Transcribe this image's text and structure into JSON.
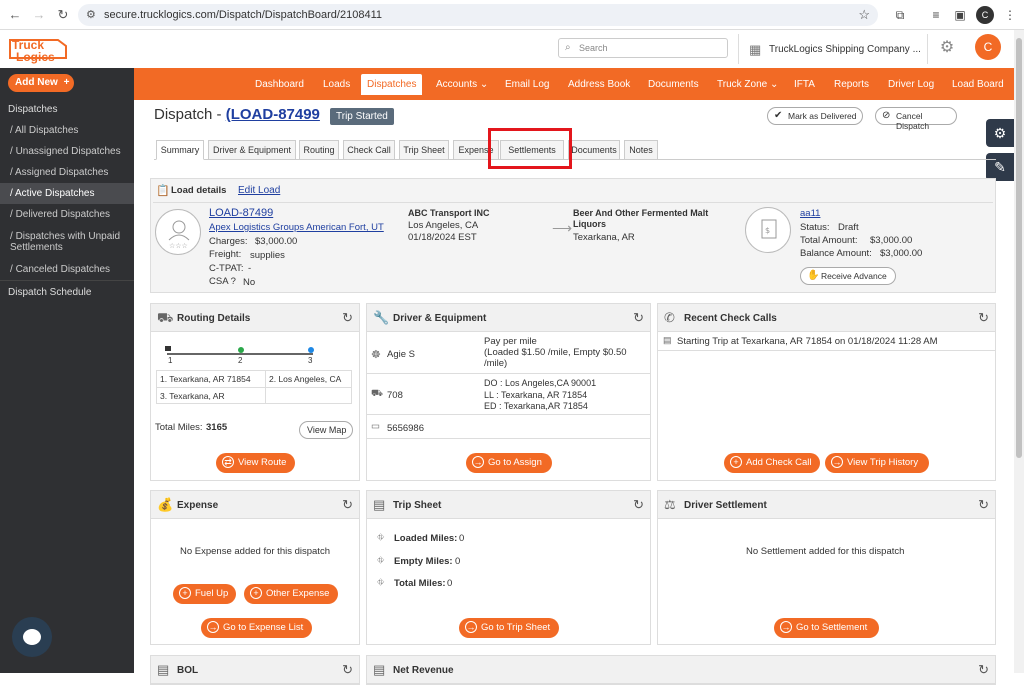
{
  "browser": {
    "url": "secure.trucklogics.com/Dispatch/DispatchBoard/2108411",
    "profile": "C"
  },
  "header": {
    "search_placeholder": "Search",
    "company": "TruckLogics Shipping Company ...",
    "avatar": "C",
    "logo": "TruckLogics"
  },
  "sidebar": {
    "add_new": "Add New",
    "section": "Dispatches",
    "items": [
      "All Dispatches",
      "Unassigned Dispatches",
      "Assigned Dispatches",
      "Active Dispatches",
      "Delivered Dispatches",
      "Dispatches with Unpaid Settlements",
      "Canceled Dispatches"
    ],
    "schedule": "Dispatch Schedule"
  },
  "topnav": [
    "Dashboard",
    "Loads",
    "Dispatches",
    "Accounts",
    "Email Log",
    "Address Book",
    "Documents",
    "Truck Zone",
    "IFTA",
    "Reports",
    "Driver Log",
    "Load Board"
  ],
  "page": {
    "title_prefix": "Dispatch - ",
    "load_link": "(LOAD-87499",
    "status": "Trip Started",
    "mark_delivered": "Mark as Delivered",
    "cancel_dispatch": "Cancel Dispatch"
  },
  "tabs": [
    "Summary",
    "Driver & Equipment",
    "Routing",
    "Check Call",
    "Trip Sheet",
    "Expense",
    "Settlements",
    "Documents",
    "Notes"
  ],
  "load": {
    "heading": "Load details",
    "edit": "Edit Load",
    "id": "LOAD-87499",
    "customer": "Apex Logistics Groups American Fort, UT",
    "charges_label": "Charges:",
    "charges": "$3,000.00",
    "freight_label": "Freight:",
    "freight": "supplies",
    "ctpat_label": "C-TPAT:",
    "ctpat": "-",
    "csa_label": "CSA ?",
    "csa": "No",
    "carrier": "ABC Transport INC",
    "origin": "Los Angeles, CA",
    "date": "01/18/2024 EST",
    "commodity": "Beer And Other Fermented Malt Liquors",
    "destination": "Texarkana, AR",
    "invoice": "aa11",
    "status_label": "Status:",
    "status": "Draft",
    "total_label": "Total Amount:",
    "total": "$3,000.00",
    "balance_label": "Balance Amount:",
    "balance": "$3,000.00",
    "receive_advance": "Receive Advance"
  },
  "routing": {
    "title": "Routing Details",
    "stops": [
      "1",
      "2",
      "3"
    ],
    "cells": [
      "1. Texarkana, AR 71854",
      "2. Los Angeles, CA",
      "3. Texarkana, AR",
      ""
    ],
    "total_label": "Total Miles:",
    "total": "3165",
    "view_map": "View Map",
    "view_route": "View Route"
  },
  "driver": {
    "title": "Driver & Equipment",
    "name": "Agie S",
    "pay_line1": "Pay per mile",
    "pay_line2": "(Loaded $1.50 /mile, Empty $0.50",
    "pay_line3": "/mile)",
    "truck": "708",
    "do": "DO :   Los Angeles,CA 90001",
    "ll": "LL :    Texarkana, AR 71854",
    "ed": "ED :   Texarkana,AR 71854",
    "trailer": "5656986",
    "go_assign": "Go to Assign"
  },
  "checkcalls": {
    "title": "Recent Check Calls",
    "entry": "Starting Trip at Texarkana, AR 71854 on 01/18/2024 11:28 AM",
    "add": "Add Check Call",
    "history": "View Trip History"
  },
  "expense": {
    "title": "Expense",
    "empty": "No Expense added for this dispatch",
    "fuel": "Fuel Up",
    "other": "Other Expense",
    "list": "Go to Expense List"
  },
  "tripsheet": {
    "title": "Trip Sheet",
    "loaded": "Loaded Miles:",
    "loaded_val": "0",
    "empty": "Empty Miles:",
    "empty_val": "0",
    "total": "Total Miles:",
    "total_val": "0",
    "go": "Go to Trip Sheet"
  },
  "settlement": {
    "title": "Driver Settlement",
    "empty": "No Settlement added for this dispatch",
    "go": "Go to Settlement"
  },
  "bottom": {
    "bol": "BOL",
    "net": "Net Revenue"
  }
}
